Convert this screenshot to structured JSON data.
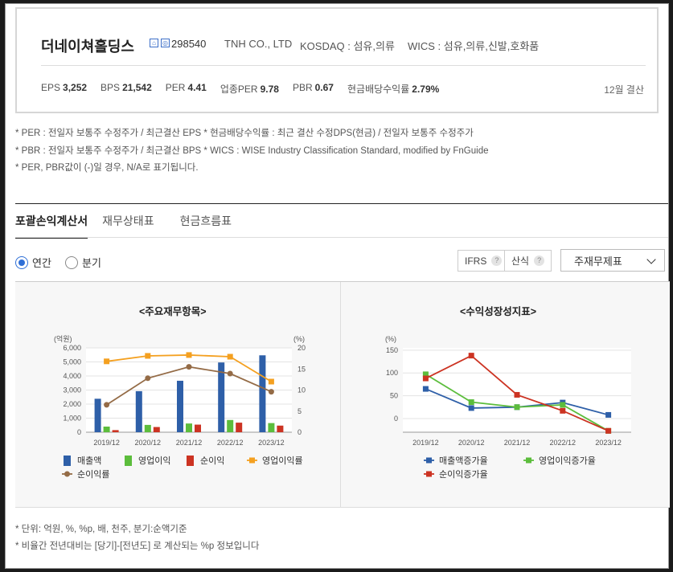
{
  "company": {
    "name": "더네이쳐홀딩스",
    "icon1": "home-icon",
    "icon2": "irb-icon",
    "code": "298540",
    "english_name": "TNH CO., LTD",
    "market": "KOSDAQ : 섬유,의류",
    "wics": "WICS : 섬유,의류,신발,호화품"
  },
  "metrics": [
    {
      "label": "EPS",
      "value": "3,252"
    },
    {
      "label": "BPS",
      "value": "21,542"
    },
    {
      "label": "PER",
      "value": "4.41"
    },
    {
      "label": "업종PER",
      "value": "9.78"
    },
    {
      "label": "PBR",
      "value": "0.67"
    },
    {
      "label": "현금배당수익률",
      "value": "2.79%"
    }
  ],
  "settlement": "12월 결산",
  "notes": [
    "* PER : 전일자 보통주 수정주가 / 최근결산 EPS * 현금배당수익률 : 최근 결산 수정DPS(현금) / 전일자 보통주 수정주가",
    "* PBR : 전일자 보통주 수정주가 / 최근결산 BPS * WICS : WISE Industry Classification Standard, modified by FnGuide",
    "* PER, PBR값이 (-)일 경우, N/A로 표기됩니다."
  ],
  "tabs": [
    "포괄손익계산서",
    "재무상태표",
    "현금흐름표"
  ],
  "period_options": [
    "연간",
    "분기"
  ],
  "toggles": {
    "ifrs": "IFRS",
    "sanshik": "산식",
    "help": "?"
  },
  "statement_select": "주재무제표",
  "footnotes": [
    "* 단위: 억원, %, %p, 배, 천주, 분기:순액기준",
    "* 비율간 전년대비는 [당기]-[전년도] 로 계산되는 %p 정보입니다"
  ],
  "chart_data": [
    {
      "type": "bar",
      "title": "<주요재무항목>",
      "categories": [
        "2019/12",
        "2020/12",
        "2021/12",
        "2022/12",
        "2023/12"
      ],
      "ylabel_left": "(억원)",
      "ylabel_right": "(%)",
      "ylim_left": [
        0,
        6000
      ],
      "ylim_right": [
        0,
        20
      ],
      "left_ticks": [
        "0",
        "1,000",
        "2,000",
        "3,000",
        "4,000",
        "5,000",
        "6,000"
      ],
      "right_ticks": [
        "0",
        "5",
        "10",
        "15",
        "20"
      ],
      "series": [
        {
          "name": "매출액",
          "kind": "bar",
          "axis": "left",
          "color": "#2e5fa8",
          "values": [
            2380,
            2920,
            3660,
            4960,
            5470
          ]
        },
        {
          "name": "영업이익",
          "kind": "bar",
          "axis": "left",
          "color": "#5cbd3c",
          "values": [
            400,
            520,
            620,
            870,
            650
          ]
        },
        {
          "name": "순이익",
          "kind": "bar",
          "axis": "left",
          "color": "#cc3322",
          "values": [
            150,
            370,
            540,
            680,
            470
          ]
        },
        {
          "name": "영업이익률",
          "kind": "line",
          "axis": "right",
          "color": "#f4a020",
          "values": [
            16.8,
            18.1,
            18.3,
            17.9,
            12.0
          ]
        },
        {
          "name": "순이익률",
          "kind": "line",
          "axis": "right",
          "color": "#946b46",
          "values": [
            6.5,
            12.8,
            15.5,
            13.9,
            9.6
          ]
        }
      ]
    },
    {
      "type": "line",
      "title": "<수익성장성지표>",
      "categories": [
        "2019/12",
        "2020/12",
        "2021/12",
        "2022/12",
        "2023/12"
      ],
      "ylabel": "(%)",
      "ylim": [
        -30,
        155
      ],
      "ticks": [
        "0",
        "50",
        "100",
        "150"
      ],
      "series": [
        {
          "name": "매출액증가율",
          "color": "#2e5fa8",
          "values": [
            65,
            23,
            25,
            35,
            8
          ]
        },
        {
          "name": "영업이익증가율",
          "color": "#5cbd3c",
          "values": [
            97,
            36,
            25,
            30,
            -27
          ]
        },
        {
          "name": "순이익증가율",
          "color": "#cc3322",
          "values": [
            88,
            138,
            52,
            17,
            -27
          ]
        }
      ]
    }
  ]
}
